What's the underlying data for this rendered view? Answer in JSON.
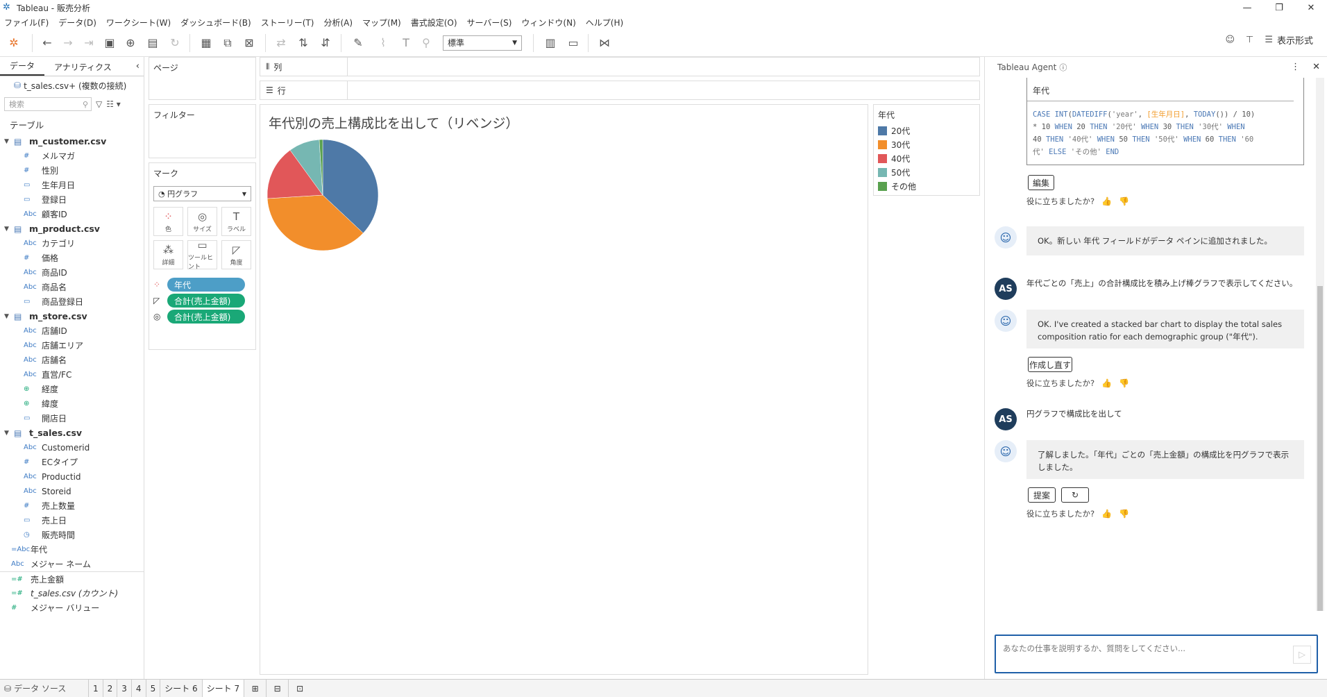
{
  "window": {
    "title": "Tableau - 販売分析"
  },
  "menu": [
    "ファイル(F)",
    "データ(D)",
    "ワークシート(W)",
    "ダッシュボード(B)",
    "ストーリー(T)",
    "分析(A)",
    "マップ(M)",
    "書式設定(O)",
    "サーバー(S)",
    "ウィンドウ(N)",
    "ヘルプ(H)"
  ],
  "toolbar": {
    "fit_value": "標準",
    "show_me": "表示形式"
  },
  "datapane": {
    "tab_data": "データ",
    "tab_analytics": "アナリティクス",
    "connection": "t_sales.csv+ (複数の接続)",
    "search_placeholder": "検索",
    "tables_header": "テーブル",
    "tables": [
      {
        "name": "m_customer.csv",
        "fields": [
          {
            "type": "#",
            "name": "メルマガ"
          },
          {
            "type": "#",
            "name": "性別"
          },
          {
            "type": "date",
            "name": "生年月日"
          },
          {
            "type": "date",
            "name": "登録日"
          },
          {
            "type": "Abc",
            "name": "顧客ID"
          }
        ]
      },
      {
        "name": "m_product.csv",
        "fields": [
          {
            "type": "Abc",
            "name": "カテゴリ"
          },
          {
            "type": "#",
            "name": "価格"
          },
          {
            "type": "Abc",
            "name": "商品ID"
          },
          {
            "type": "Abc",
            "name": "商品名"
          },
          {
            "type": "date",
            "name": "商品登録日"
          }
        ]
      },
      {
        "name": "m_store.csv",
        "fields": [
          {
            "type": "Abc",
            "name": "店舗ID"
          },
          {
            "type": "Abc",
            "name": "店舗エリア"
          },
          {
            "type": "Abc",
            "name": "店舗名"
          },
          {
            "type": "Abc",
            "name": "直営/FC"
          },
          {
            "type": "geo",
            "name": "経度"
          },
          {
            "type": "geo",
            "name": "緯度"
          },
          {
            "type": "date",
            "name": "開店日"
          }
        ]
      },
      {
        "name": "t_sales.csv",
        "fields": [
          {
            "type": "Abc",
            "name": "Customerid"
          },
          {
            "type": "#",
            "name": "ECタイプ"
          },
          {
            "type": "Abc",
            "name": "Productid"
          },
          {
            "type": "Abc",
            "name": "Storeid"
          },
          {
            "type": "#",
            "name": "売上数量"
          },
          {
            "type": "date",
            "name": "売上日"
          },
          {
            "type": "datetime",
            "name": "販売時間"
          }
        ]
      }
    ],
    "top_fields": [
      {
        "type": "=Abc",
        "name": "年代",
        "italic": false
      },
      {
        "type": "Abc",
        "name": "メジャー ネーム",
        "italic": false
      },
      {
        "type": "=#",
        "name": "売上金額",
        "italic": false
      },
      {
        "type": "=#",
        "name": "t_sales.csv (カウント)",
        "italic": true
      },
      {
        "type": "#",
        "name": "メジャー バリュー",
        "italic": false
      }
    ]
  },
  "shelves": {
    "pages": "ページ",
    "filters": "フィルター",
    "marks": "マーク",
    "mark_type": "円グラフ",
    "mark_buttons": [
      "色",
      "サイズ",
      "ラベル",
      "詳細",
      "ツールヒント",
      "角度"
    ],
    "mark_pills": [
      {
        "label": "年代",
        "color": "#4d9ec7"
      },
      {
        "label": "合計(売上金額)",
        "color": "#1aa877"
      },
      {
        "label": "合計(売上金額)",
        "color": "#1aa877"
      }
    ],
    "columns": "列",
    "rows": "行"
  },
  "view": {
    "title": "年代別の売上構成比を出して（リベンジ）"
  },
  "chart_data": {
    "type": "pie",
    "title": "年代別の売上構成比を出して（リベンジ）",
    "legend_title": "年代",
    "legend_position": "right",
    "categories": [
      "20代",
      "30代",
      "40代",
      "50代",
      "その他"
    ],
    "values": [
      37,
      37,
      16,
      9,
      1
    ],
    "colors": [
      "#4e79a7",
      "#f28e2b",
      "#e15759",
      "#76b7b2",
      "#59a14f"
    ]
  },
  "agent": {
    "title": "Tableau Agent",
    "code_header": "年代",
    "edit_button": "編集",
    "feedback_prompt": "役に立ちましたか?",
    "msg1": "OK。新しい 年代 フィールドがデータ ペインに追加されました。",
    "user_initials": "AS",
    "user1": "年代ごとの「売上」の合計構成比を積み上げ棒グラフで表示してください。",
    "msg2": "OK. I've created a stacked bar chart to display the total sales composition ratio for each demographic group (\"年代\").",
    "redo_button": "作成し直す",
    "user2": "円グラフで構成比を出して",
    "msg3": "了解しました。「年代」ごとの「売上金額」の構成比を円グラフで表示しました。",
    "suggest_button": "提案",
    "input_placeholder": "あなたの仕事を説明するか、質問をしてください..."
  },
  "bottom_tabs": [
    "データ ソース",
    "1",
    "2",
    "3",
    "4",
    "5",
    "シート 6",
    "シート 7"
  ]
}
